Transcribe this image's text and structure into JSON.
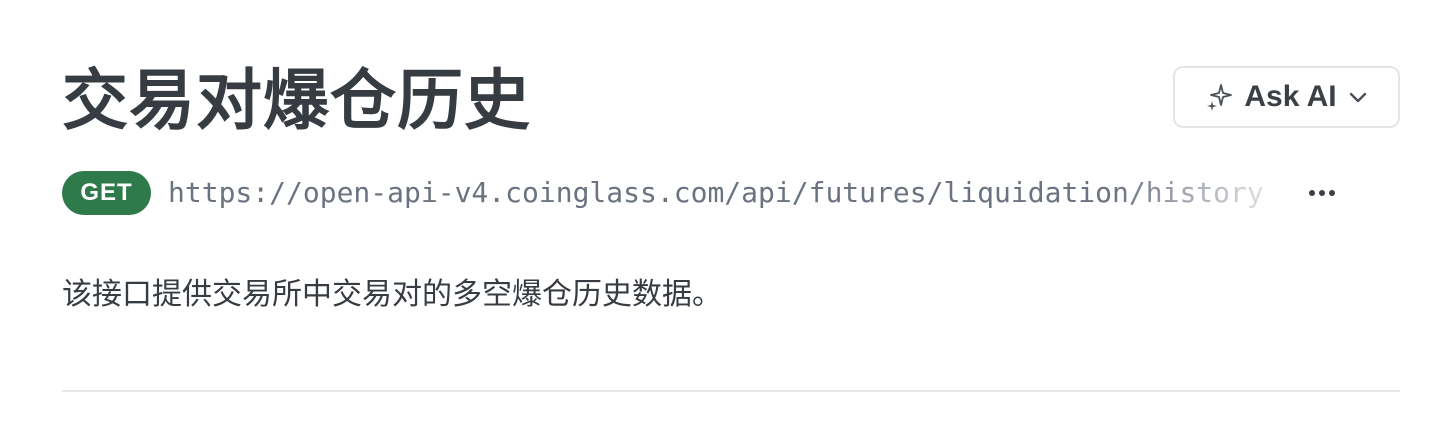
{
  "page": {
    "title": "交易对爆仓历史",
    "description": "该接口提供交易所中交易对的多空爆仓历史数据。"
  },
  "ask_ai": {
    "label": "Ask AI",
    "icon": "sparkle-icon",
    "dropdown_icon": "chevron-down-icon"
  },
  "endpoint": {
    "method": "GET",
    "url": "https://open-api-v4.coinglass.com/api/futures/liquidation/history",
    "more_icon": "more-icon"
  },
  "colors": {
    "method_get": "#2f7a4a",
    "text": "#373c42",
    "url_text": "#6b7380",
    "border": "#e3e5e8"
  }
}
